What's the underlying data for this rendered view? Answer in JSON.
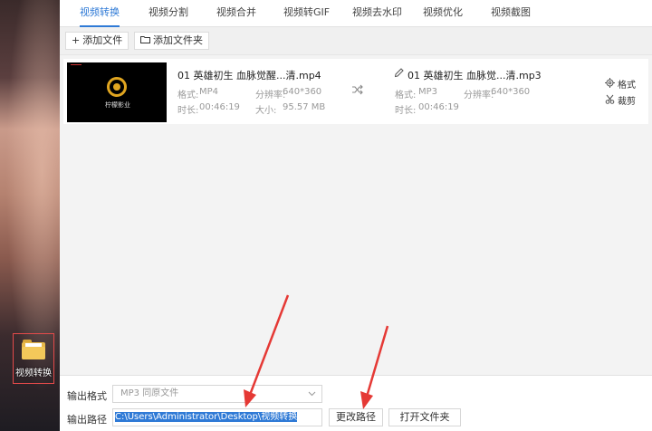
{
  "desktop": {
    "folder_label": "视频转换"
  },
  "tabs": [
    {
      "label": "视频转换",
      "active": true
    },
    {
      "label": "视频分割",
      "active": false
    },
    {
      "label": "视频合并",
      "active": false
    },
    {
      "label": "视频转GIF",
      "active": false
    },
    {
      "label": "视频去水印",
      "active": false
    },
    {
      "label": "视频优化",
      "active": false
    },
    {
      "label": "视频截图",
      "active": false
    }
  ],
  "toolbar": {
    "add_file": "添加文件",
    "add_folder": "添加文件夹"
  },
  "file": {
    "thumb_logo_text": "柠檬影业",
    "source": {
      "name": "01 英雄初生 血脉觉醒...清.mp4",
      "format_label": "格式:",
      "format": "MP4",
      "resolution_label": "分辨率:",
      "resolution": "640*360",
      "duration_label": "时长:",
      "duration": "00:46:19",
      "size_label": "大小:",
      "size": "95.57 MB"
    },
    "output": {
      "name": "01 英雄初生 血脉觉...清.mp3",
      "format_label": "格式:",
      "format": "MP3",
      "resolution_label": "分辨率:",
      "resolution": "640*360",
      "duration_label": "时长:",
      "duration": "00:46:19"
    },
    "actions": {
      "format": "格式",
      "crop": "裁剪"
    }
  },
  "bottom": {
    "output_format_label": "输出格式",
    "output_format_value": "MP3  同原文件",
    "output_path_label": "输出路径",
    "output_path_value": "C:\\Users\\Administrator\\Desktop\\视频转换",
    "change_path_button": "更改路径",
    "open_folder_button": "打开文件夹"
  },
  "colors": {
    "accent": "#2f7ad6",
    "annotation": "#e53935"
  }
}
